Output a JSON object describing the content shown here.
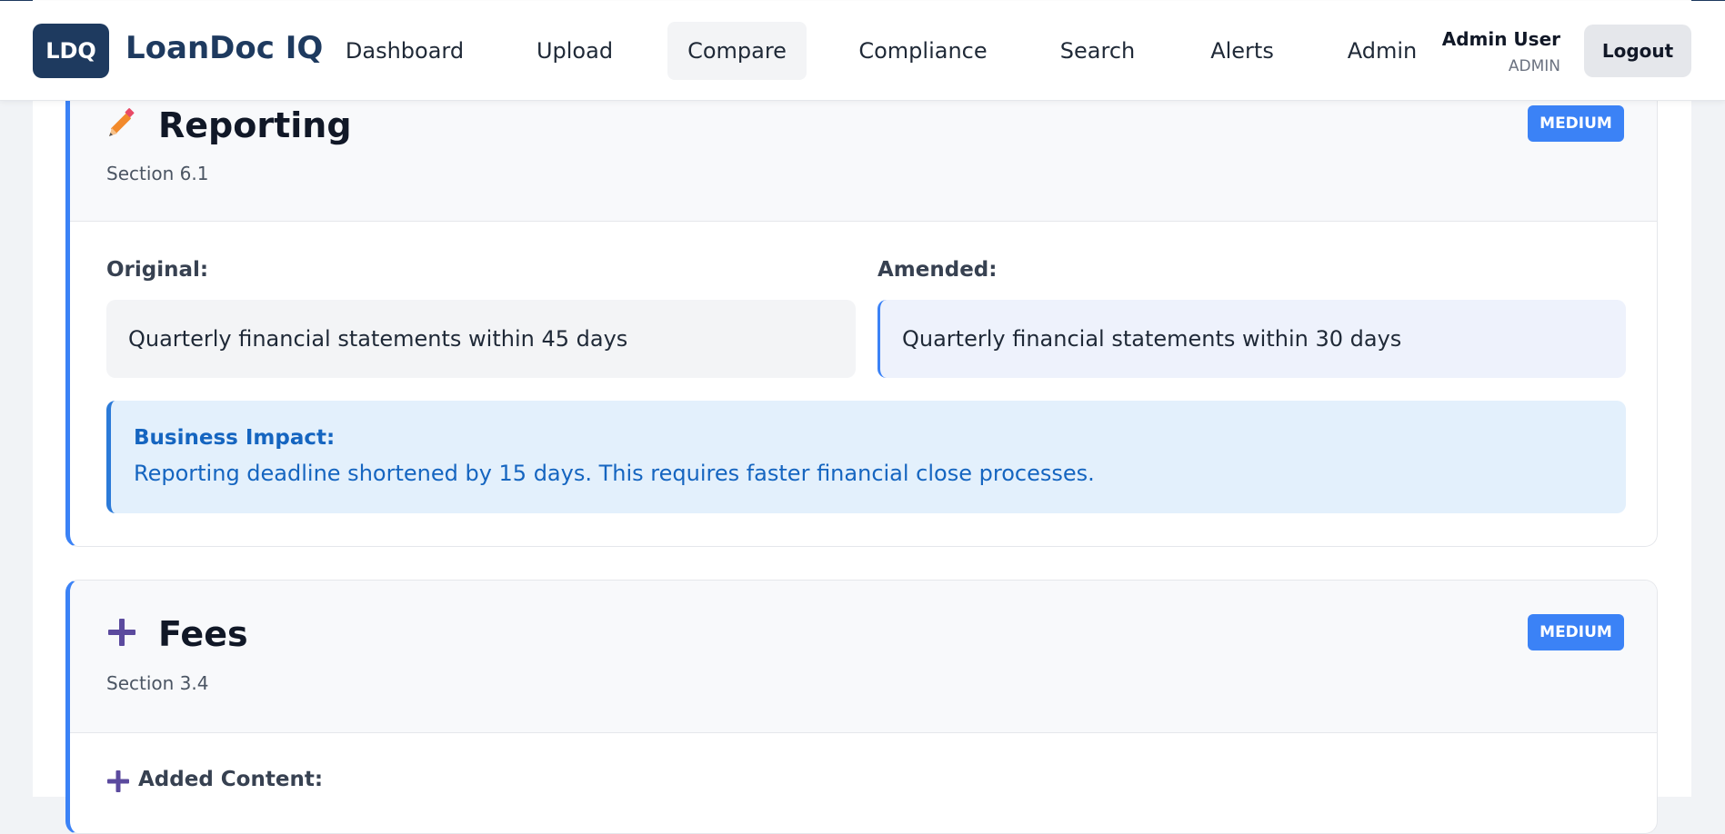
{
  "header": {
    "logo": "LDQ",
    "app_name": "LoanDoc IQ",
    "nav": [
      "Dashboard",
      "Upload",
      "Compare",
      "Compliance",
      "Search",
      "Alerts",
      "Admin"
    ],
    "active_nav": "Compare",
    "user_name": "Admin User",
    "user_role": "ADMIN",
    "logout_label": "Logout"
  },
  "changes": [
    {
      "icon": "pencil-icon",
      "title": "Reporting",
      "section": "Section 6.1",
      "severity": "MEDIUM",
      "original_label": "Original:",
      "original_text": "Quarterly financial statements within 45 days",
      "amended_label": "Amended:",
      "amended_text": "Quarterly financial statements within 30 days",
      "impact_label": "Business Impact:",
      "impact_text": "Reporting deadline shortened by 15 days. This requires faster financial close processes."
    },
    {
      "icon": "plus-icon",
      "title": "Fees",
      "section": "Section 3.4",
      "severity": "MEDIUM",
      "added_label": "Added Content:"
    }
  ],
  "colors": {
    "brand": "#1e3a5f",
    "accent": "#3b82f6",
    "impact_text": "#1565c0",
    "impact_bg": "#e3f0fc"
  }
}
